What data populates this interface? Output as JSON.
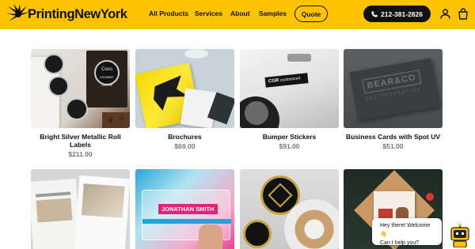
{
  "brand": {
    "name": "PrintingNewYork",
    "accent": "#fdc300"
  },
  "nav": [
    {
      "label": "All Products"
    },
    {
      "label": "Services"
    },
    {
      "label": "About"
    },
    {
      "label": "Samples"
    }
  ],
  "header": {
    "quote_label": "Quote",
    "phone_label": "212-381-2826",
    "icons": [
      "phone-icon",
      "user-icon",
      "cart-icon"
    ]
  },
  "products": [
    {
      "title": "Bright Silver Metallic Roll Labels",
      "price": "$211.00"
    },
    {
      "title": "Brochures",
      "price": "$69.00"
    },
    {
      "title": "Bumper Stickers",
      "price": "$91.00"
    },
    {
      "title": "Business Cards with Spot UV",
      "price": "$51.00"
    },
    {
      "title": "",
      "price": ""
    },
    {
      "title": "",
      "price": ""
    },
    {
      "title": "",
      "price": ""
    },
    {
      "title": "",
      "price": ""
    }
  ],
  "image_text": {
    "labels_top": "GOURMET COFFEE",
    "labels_logo": "Coco",
    "bumper": "CGR",
    "bumper_sub": "customized",
    "bizcard_1": "BEAR&CO",
    "bizcard_2": "BOT PROPERTIES",
    "clear_card": "JONATHAN SMITH"
  },
  "chat": {
    "line1": "Hey there! Welcome 👋",
    "line2": "Can I help you?"
  }
}
